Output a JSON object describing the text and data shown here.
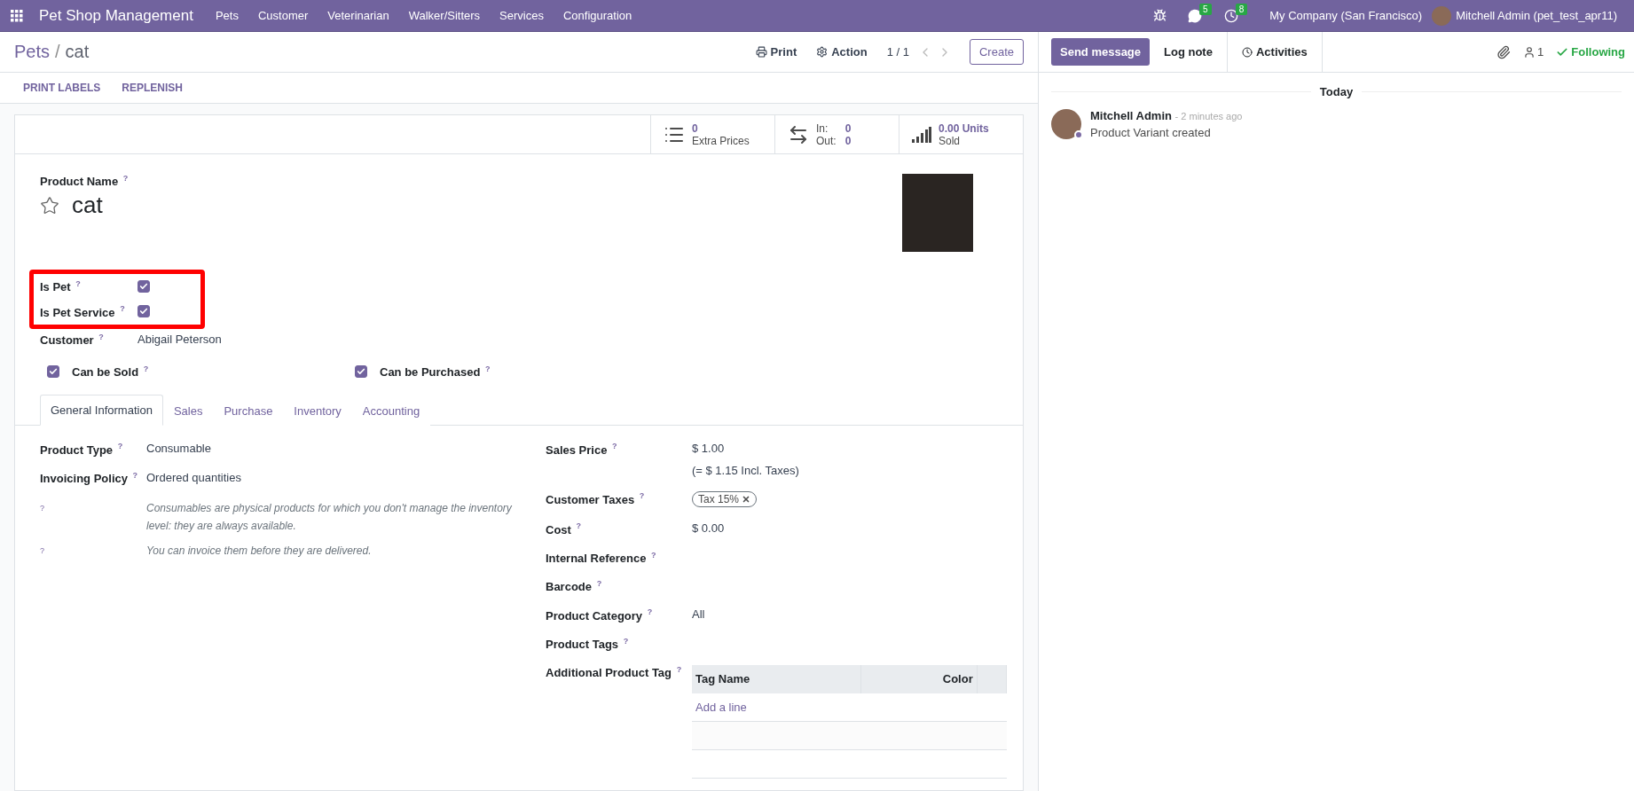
{
  "navbar": {
    "app_name": "Pet Shop Management",
    "menus": [
      "Pets",
      "Customer",
      "Veterinarian",
      "Walker/Sitters",
      "Services",
      "Configuration"
    ],
    "messages_count": "5",
    "activities_count": "8",
    "company": "My Company (San Francisco)",
    "user": "Mitchell Admin (pet_test_apr11)"
  },
  "control_panel": {
    "breadcrumb": [
      "Pets",
      "cat"
    ],
    "breadcrumb_separator": "/",
    "print": "Print",
    "action": "Action",
    "pager": "1 / 1",
    "create": "Create"
  },
  "action_buttons": [
    "PRINT LABELS",
    "REPLENISH"
  ],
  "stat_buttons": [
    {
      "kind": "list",
      "value": "0",
      "label": "Extra Prices"
    },
    {
      "kind": "transfer",
      "in_label": "In:",
      "in_value": "0",
      "out_label": "Out:",
      "out_value": "0"
    },
    {
      "kind": "chart",
      "value": "0.00 Units",
      "label": "Sold"
    }
  ],
  "product": {
    "name_label": "Product Name $^{?}$",
    "name": "cat",
    "favorite": false
  },
  "flags": {
    "highlighted": true,
    "items": [
      {
        "label": "Is Pet $^{?}$",
        "checked": true
      },
      {
        "label": "Is Pet Service $^{?}$",
        "checked": true
      }
    ]
  },
  "customer": {
    "label": "Customer $^{?}$",
    "value": "Abigail Peterson"
  },
  "options": [
    {
      "label": "Can be Sold $^{?}$",
      "checked": true
    },
    {
      "label": "Can be Purchased $^{?}$",
      "checked": true
    }
  ],
  "tabs": [
    {
      "label": "General Information",
      "selected": true
    },
    {
      "label": "Sales",
      "selected": false
    },
    {
      "label": "Purchase",
      "selected": false
    },
    {
      "label": "Inventory",
      "selected": false
    },
    {
      "label": "Accounting",
      "selected": false
    }
  ],
  "left_fields": [
    {
      "label": "Product Type $^{?}$",
      "value": "Consumable"
    },
    {
      "label": "Invoicing Policy $^{?}$",
      "value": "Ordered quantities"
    }
  ],
  "notes": [
    {
      "help": "?",
      "text": "Consumables are physical products for which you don't manage the inventory level: they are always available."
    },
    {
      "help": "?",
      "text": "You can invoice them before they are delivered."
    }
  ],
  "right_fields": [
    {
      "kind": "text",
      "label": "Sales Price $^{?}$",
      "value": "$ 1.00",
      "sub": "(= $ 1.15 Incl. Taxes)"
    },
    {
      "kind": "tags",
      "label": "Customer Taxes $^{?}$",
      "tags": [
        "Tax 15%"
      ]
    },
    {
      "kind": "text",
      "label": "Cost $^{?}$",
      "value": "$ 0.00"
    },
    {
      "kind": "empty",
      "label": "Internal Reference $^{?}$"
    },
    {
      "kind": "empty",
      "label": "Barcode $^{?}$"
    },
    {
      "kind": "text",
      "label": "Product Category $^{?}$",
      "value": "All"
    },
    {
      "kind": "empty",
      "label": "Product Tags $^{?}$"
    },
    {
      "kind": "table",
      "label": "Additional Product Tag $^{?}$",
      "columns": [
        "Tag Name",
        "Color"
      ],
      "add_line": "Add a line"
    }
  ],
  "chatter": {
    "send_message": "Send message",
    "log_note": "Log note",
    "activities": "Activities",
    "followers": "1",
    "following": "Following",
    "date": "Today",
    "messages": [
      {
        "author": "Mitchell Admin",
        "time": "- 2 minutes ago",
        "body": "Product Variant created"
      }
    ]
  }
}
